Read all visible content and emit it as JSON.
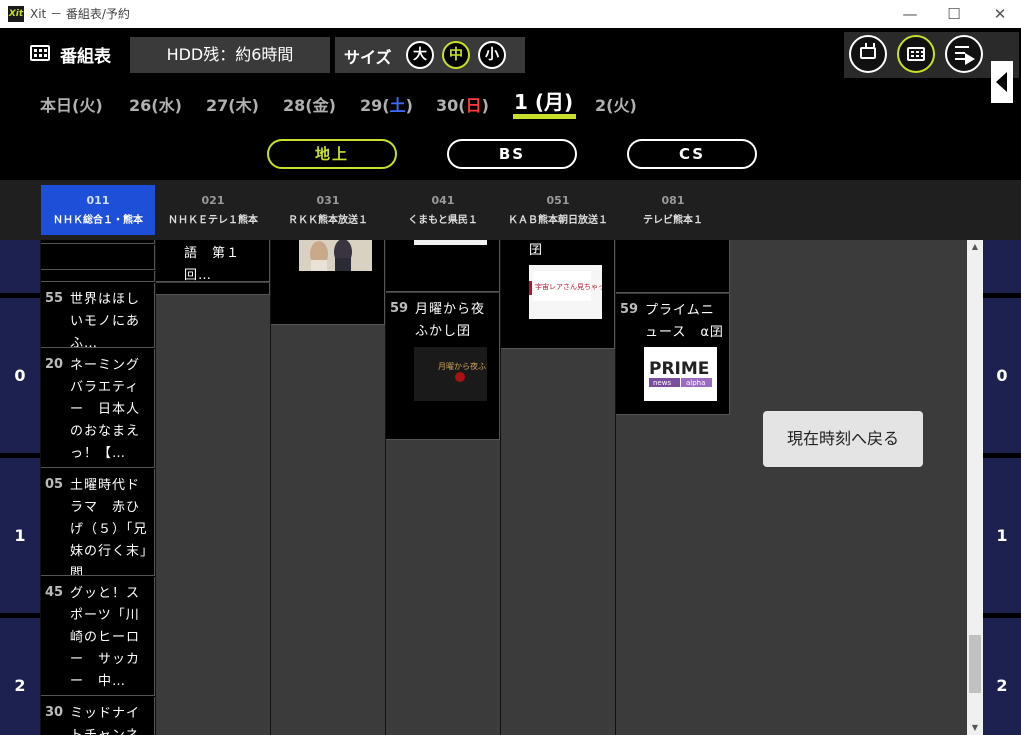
{
  "window": {
    "title": "Xit － 番組表/予約",
    "app_icon": "Xit"
  },
  "header": {
    "title": "番組表",
    "hdd": "HDD残：約6時間",
    "size_label": "サイズ",
    "sizes": [
      "大",
      "中",
      "小"
    ],
    "active_size": "中"
  },
  "dates": [
    {
      "label": "本日(火)"
    },
    {
      "label": "26(水)"
    },
    {
      "label": "27(木)"
    },
    {
      "label": "28(金)"
    },
    {
      "pre": "29(",
      "day": "土",
      "post": ")"
    },
    {
      "pre": "30(",
      "day": "日",
      "post": ")"
    },
    {
      "label": "1 (月)",
      "current": true
    },
    {
      "label": "2(火)"
    }
  ],
  "bands": [
    "地上",
    "BS",
    "CS"
  ],
  "active_band": "地上",
  "channels": [
    {
      "num": "011",
      "name": "ＮＨＫ総合１・熊本",
      "active": true
    },
    {
      "num": "021",
      "name": "ＮＨＫＥテレ１熊本"
    },
    {
      "num": "031",
      "name": "ＲＫＫ熊本放送１"
    },
    {
      "num": "041",
      "name": "くまもと県民１"
    },
    {
      "num": "051",
      "name": "ＫＡＢ熊本朝日放送１"
    },
    {
      "num": "081",
      "name": "テレビ熊本１"
    }
  ],
  "hours": [
    "0",
    "1",
    "2"
  ],
  "programs": {
    "nhk": [
      {
        "min": "55",
        "text": "世界はほしいモノにあふ…"
      },
      {
        "min": "20",
        "text": "ネーミングバラエティー　日本人のおなまえっ！【…"
      },
      {
        "min": "05",
        "text": "土曜時代ドラマ　赤ひげ（５）「兄妹の行く末」閻…"
      },
      {
        "min": "45",
        "text": "グッと！スポーツ「川崎のヒーロー　サッカー　中…"
      },
      {
        "min": "30",
        "text": "ミッドナイトチャンネル"
      }
    ],
    "etv": [
      {
        "text": "語　第１回…"
      }
    ],
    "kab": [
      {
        "text": "囝"
      }
    ],
    "kumamoto_kenmin": [
      {
        "min": "59",
        "text": "月曜から夜ふかし囝"
      }
    ],
    "tv_kumamoto": [
      {
        "min": "59",
        "text": "プライムニュース　α囝"
      }
    ]
  },
  "thumbnails": {
    "kab": "宇宙レアさん見ちゃった",
    "yofukashi": "月曜から夜ふかし",
    "prime_title": "PRIME",
    "prime_sub1": "news",
    "prime_sub2": "alpha"
  },
  "now_button": "現在時刻へ戻る"
}
